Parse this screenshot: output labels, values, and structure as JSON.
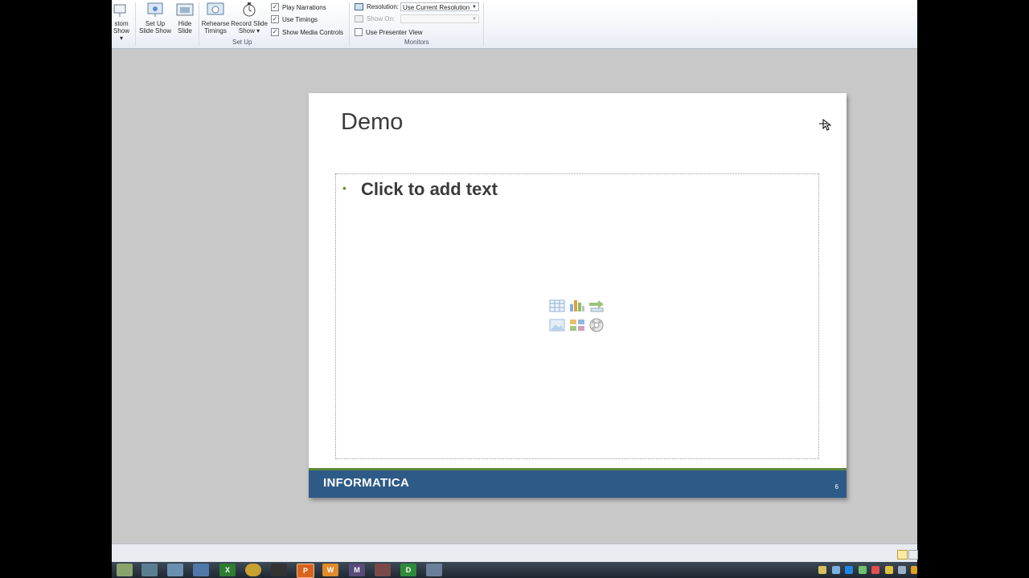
{
  "ribbon": {
    "custom_show_line1": "stom",
    "custom_show_line2": "Show",
    "setup_line1": "Set Up",
    "setup_line2": "Slide Show",
    "hide_line1": "Hide",
    "hide_line2": "Slide",
    "rehearse_line1": "Rehearse",
    "rehearse_line2": "Timings",
    "record_line1": "Record Slide",
    "record_line2": "Show",
    "play_narrations": "Play Narrations",
    "use_timings": "Use Timings",
    "show_media_controls": "Show Media Controls",
    "group_setup": "Set Up",
    "resolution_label": "Resolution:",
    "resolution_value": "Use Current Resolution",
    "show_on_label": "Show On:",
    "use_presenter_view": "Use Presenter View",
    "group_monitors": "Monitors"
  },
  "slide": {
    "title": "Demo",
    "content_placeholder": "Click to add text",
    "logo": "INFORMATICA",
    "slide_number": "6"
  },
  "colors": {
    "footer": "#2e5a87",
    "footer_accent": "#5b8a3a",
    "bullet": "#6b8e23"
  },
  "taskbar": {
    "excel": "X",
    "powerpoint": "P",
    "word": "W",
    "m_app": "M",
    "d_app": "D"
  }
}
